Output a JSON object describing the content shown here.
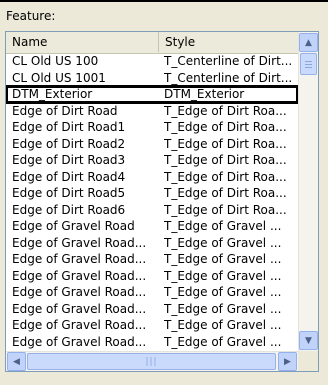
{
  "feature_label": "Feature:",
  "columns": {
    "name": "Name",
    "style": "Style"
  },
  "rows": [
    {
      "name": "CL Old US 100",
      "style": "T_Centerline of Dirt..."
    },
    {
      "name": "CL Old US 1001",
      "style": "T_Centerline of Dirt..."
    },
    {
      "name": "DTM_Exterior",
      "style": "DTM_Exterior"
    },
    {
      "name": "Edge of Dirt Road",
      "style": "T_Edge of Dirt Roa..."
    },
    {
      "name": "Edge of Dirt Road1",
      "style": "T_Edge of Dirt Roa..."
    },
    {
      "name": "Edge of Dirt Road2",
      "style": "T_Edge of Dirt Roa..."
    },
    {
      "name": "Edge of Dirt Road3",
      "style": "T_Edge of Dirt Roa..."
    },
    {
      "name": "Edge of Dirt Road4",
      "style": "T_Edge of Dirt Roa..."
    },
    {
      "name": "Edge of Dirt Road5",
      "style": "T_Edge of Dirt Roa..."
    },
    {
      "name": "Edge of Dirt Road6",
      "style": "T_Edge of Dirt Roa..."
    },
    {
      "name": "Edge of Gravel Road",
      "style": "T_Edge of Gravel ..."
    },
    {
      "name": "Edge of Gravel Road...",
      "style": "T_Edge of Gravel ..."
    },
    {
      "name": "Edge of Gravel Road...",
      "style": "T_Edge of Gravel ..."
    },
    {
      "name": "Edge of Gravel Road...",
      "style": "T_Edge of Gravel ..."
    },
    {
      "name": "Edge of Gravel Road...",
      "style": "T_Edge of Gravel ..."
    },
    {
      "name": "Edge of Gravel Road...",
      "style": "T_Edge of Gravel ..."
    },
    {
      "name": "Edge of Gravel Road...",
      "style": "T_Edge of Gravel ..."
    },
    {
      "name": "Edge of Gravel Road...",
      "style": "T_Edge of Gravel ..."
    }
  ],
  "selected_row": 2,
  "scrollbar_icons": {
    "up": "scroll-up-arrow-icon",
    "down": "scroll-down-arrow-icon",
    "left": "scroll-left-arrow-icon",
    "right": "scroll-right-arrow-icon"
  },
  "colors": {
    "selection_outline": "#000000",
    "scrollbar": "#c1d3fb"
  }
}
